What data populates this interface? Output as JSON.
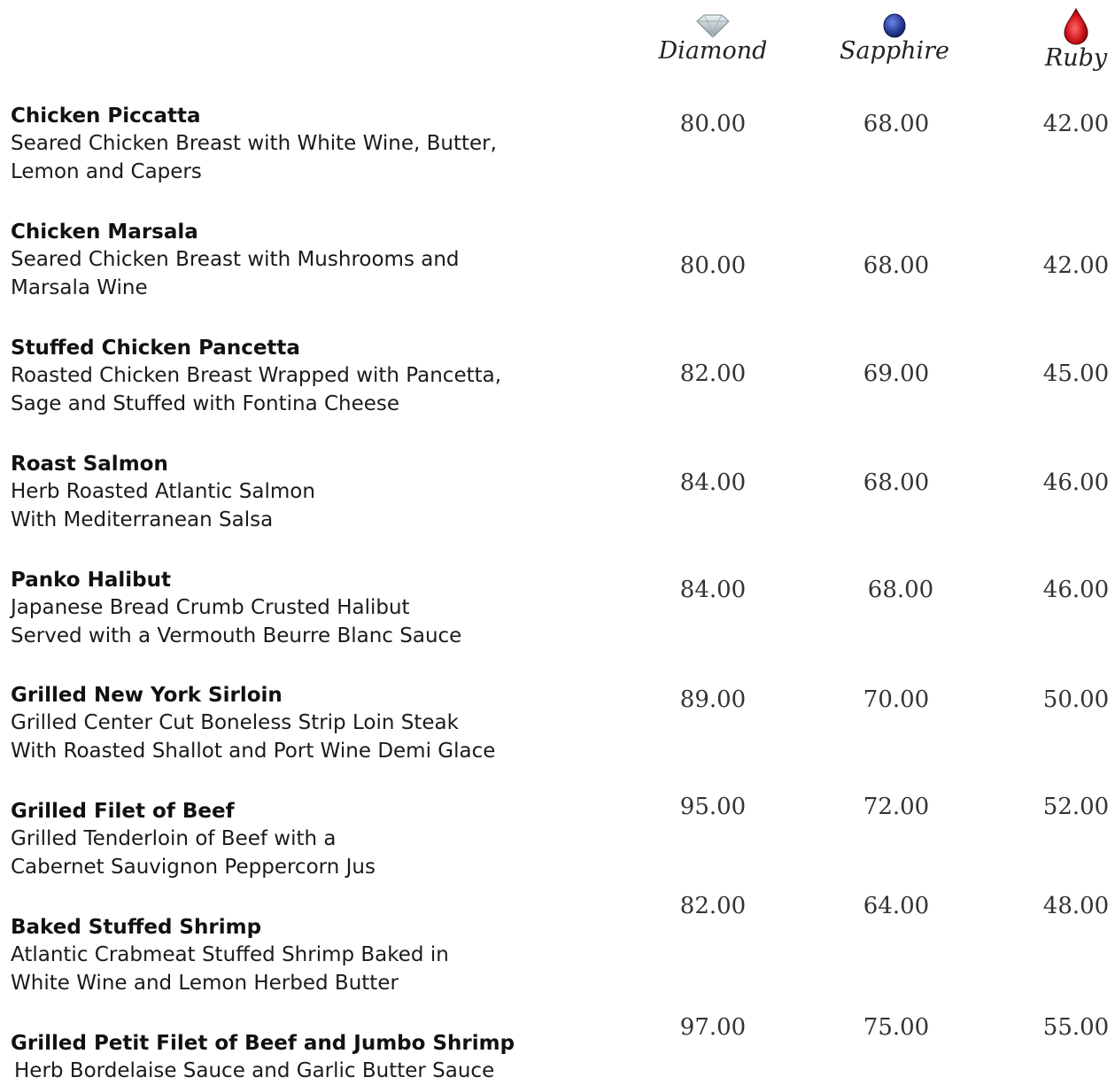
{
  "tiers": [
    {
      "label": "Diamond",
      "icon": "diamond-gem-icon",
      "color": "#c9d3d8"
    },
    {
      "label": "Sapphire",
      "icon": "sapphire-gem-icon",
      "color": "#2a3f9e"
    },
    {
      "label": "Ruby",
      "icon": "ruby-gem-icon",
      "color": "#d0141c"
    }
  ],
  "items": [
    {
      "name": "Chicken Piccatta",
      "desc": [
        "Seared Chicken Breast with White Wine, Butter,",
        "Lemon and Capers"
      ],
      "prices": [
        "80.00",
        "68.00",
        "42.00"
      ]
    },
    {
      "name": "Chicken Marsala",
      "desc": [
        "Seared Chicken Breast with Mushrooms and",
        "Marsala Wine"
      ],
      "prices": [
        "80.00",
        "68.00",
        "42.00"
      ]
    },
    {
      "name": "Stuffed Chicken Pancetta",
      "desc": [
        "Roasted Chicken Breast Wrapped with Pancetta,",
        "Sage and Stuffed with Fontina Cheese"
      ],
      "prices": [
        "82.00",
        "69.00",
        "45.00"
      ]
    },
    {
      "name": "Roast Salmon",
      "desc": [
        "Herb Roasted Atlantic Salmon",
        "With Mediterranean Salsa"
      ],
      "prices": [
        "84.00",
        "68.00",
        "46.00"
      ]
    },
    {
      "name": "Panko Halibut",
      "desc": [
        "Japanese Bread Crumb Crusted Halibut",
        "Served with a Vermouth Beurre Blanc Sauce"
      ],
      "prices": [
        "84.00",
        "68.00",
        "46.00"
      ]
    },
    {
      "name": "Grilled New York Sirloin",
      "desc": [
        "Grilled Center Cut Boneless Strip Loin Steak",
        "With Roasted Shallot and Port Wine Demi Glace"
      ],
      "prices": [
        "89.00",
        "70.00",
        "50.00"
      ]
    },
    {
      "name": "Grilled Filet of Beef",
      "desc": [
        "Grilled Tenderloin of Beef with a",
        "Cabernet Sauvignon Peppercorn Jus"
      ],
      "prices": [
        "95.00",
        "72.00",
        "52.00"
      ]
    },
    {
      "name": "Baked Stuffed Shrimp",
      "desc": [
        "Atlantic Crabmeat Stuffed Shrimp Baked in",
        "White Wine and Lemon Herbed Butter"
      ],
      "prices": [
        "82.00",
        "64.00",
        "48.00"
      ]
    },
    {
      "name": "Grilled Petit Filet of Beef and Jumbo Shrimp",
      "desc": [
        "Herb Bordelaise Sauce and Garlic Butter Sauce"
      ],
      "prices": [
        "97.00",
        "75.00",
        "55.00"
      ]
    }
  ]
}
